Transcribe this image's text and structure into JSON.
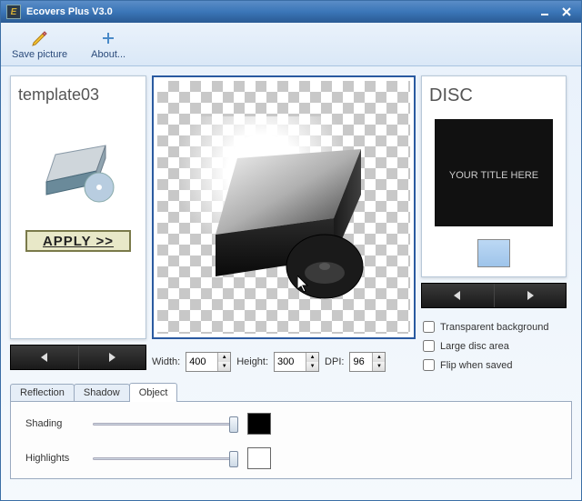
{
  "window": {
    "title": "Ecovers Plus V3.0",
    "icon_text": "E"
  },
  "toolbar": {
    "save_label": "Save picture",
    "about_label": "About..."
  },
  "left": {
    "title": "template03",
    "apply_label": "APPLY >>"
  },
  "center": {
    "width_label": "Width:",
    "height_label": "Height:",
    "dpi_label": "DPI:",
    "width_value": "400",
    "height_value": "300",
    "dpi_value": "96"
  },
  "right": {
    "title": "DISC",
    "thumb_text": "YOUR TITLE HERE",
    "swatch_color": "#a8cdf0",
    "checks": {
      "transparent": "Transparent background",
      "large_disc": "Large disc area",
      "flip": "Flip when saved"
    }
  },
  "tabs": {
    "reflection": "Reflection",
    "shadow": "Shadow",
    "object": "Object",
    "shading_label": "Shading",
    "highlights_label": "Highlights",
    "shading_color": "#000000",
    "highlights_color": "#ffffff"
  }
}
